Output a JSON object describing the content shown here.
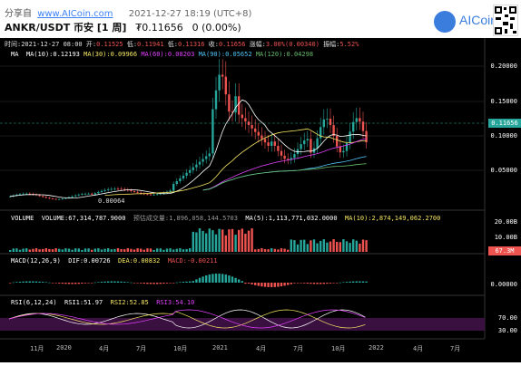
{
  "header": {
    "share_label": "分享自",
    "site": "www.AICoin.com",
    "datetime": "2021-12-27 18:19 (UTC+8)",
    "pair": "ANKR/USDT 币安",
    "period": "[1 周]",
    "price": "₮0.11656",
    "change": "0 (0.00%)",
    "logo_text": "AICoin"
  },
  "ohlc": {
    "time_label": "时间:",
    "time": "2021-12-27 08:00",
    "open_label": "开:",
    "open": "0.11525",
    "high_label": "低:",
    "high": "0.11941",
    "low_label": "低:",
    "low": "0.11316",
    "close_label": "收:",
    "close": "0.11656",
    "change_label": "涨幅:",
    "change": "3.00%(0.00340)",
    "amp_label": "振幅:",
    "amp": "5.52%"
  },
  "ma": {
    "label": "MA",
    "ma10": "MA(10):0.12193",
    "ma30": "MA(30):0.09966",
    "ma60": "MA(60):0.08203",
    "ma90": "MA(90):0.05652",
    "ma120": "MA(120):0.04298"
  },
  "main_axis": [
    "0.20000",
    "0.15000",
    "0.10000",
    "0.05000"
  ],
  "current_price_tag": "0.11656",
  "min_price_label": "0.00064",
  "volume": {
    "label": "VOLUME",
    "vol": "VOLUME:67,314,787.9000",
    "pred": "预估成交量:1,896,058,144.5703",
    "ma5": "MA(5):1,113,771,032.0000",
    "ma10": "MA(10):2,874,149,062.2700",
    "axis": [
      "20.00B",
      "10.00B"
    ],
    "tag": "67.3M"
  },
  "macd": {
    "label": "MACD(12,26,9)",
    "dif": "DIF:0.00726",
    "dea": "DEA:0.00832",
    "macd": "MACD:-0.00211",
    "axis": [
      "0.00000"
    ]
  },
  "rsi": {
    "label": "RSI(6,12,24)",
    "rsi1": "RSI1:51.97",
    "rsi2": "RSI2:52.85",
    "rsi3": "RSI3:54.10",
    "axis": [
      "70.00",
      "30.00"
    ]
  },
  "x_axis": [
    "11月",
    "2020",
    "4月",
    "7月",
    "10月",
    "2021",
    "4月",
    "7月",
    "10月",
    "2022",
    "4月",
    "7月"
  ],
  "colors": {
    "up": "#26a69a",
    "down": "#ef5350",
    "ma10": "#ffffff",
    "ma30": "#f5e663",
    "ma60": "#e040fb",
    "ma90": "#4fc3f7",
    "ma120": "#66bb6a"
  }
}
